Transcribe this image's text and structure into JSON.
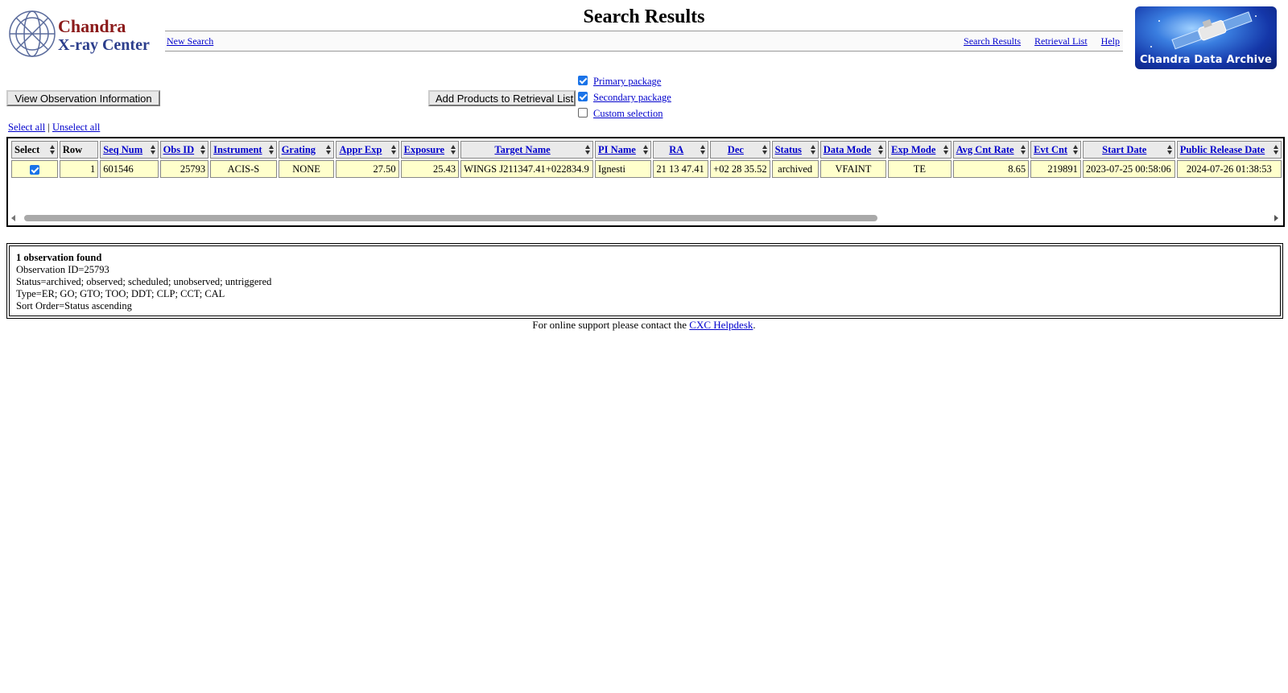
{
  "header": {
    "logo_line1": "Chandra",
    "logo_line2": "X-ray Center",
    "title": "Search Results",
    "right_logo_text": "Chandra Data Archive"
  },
  "nav": {
    "new_search": "New Search",
    "links": [
      "Search Results",
      "Retrieval List",
      "Help"
    ]
  },
  "actions": {
    "view_obs_button": "View Observation Information",
    "add_products_button": "Add Products to Retrieval List",
    "packages": [
      {
        "label": "Primary package",
        "checked": true
      },
      {
        "label": "Secondary package",
        "checked": true
      },
      {
        "label": "Custom selection",
        "checked": false
      }
    ],
    "select_all": "Select all",
    "separator": "|",
    "unselect_all": "Unselect all"
  },
  "table": {
    "columns": [
      "Select",
      "Row",
      "Seq Num",
      "Obs ID",
      "Instrument",
      "Grating",
      "Appr Exp",
      "Exposure",
      "Target Name",
      "PI Name",
      "RA",
      "Dec",
      "Status",
      "Data Mode",
      "Exp Mode",
      "Avg Cnt Rate",
      "Evt Cnt",
      "Start Date",
      "Public Release Date"
    ],
    "rows": [
      {
        "selected": true,
        "row": "1",
        "seq_num": "601546",
        "obs_id": "25793",
        "instrument": "ACIS-S",
        "grating": "NONE",
        "appr_exp": "27.50",
        "exposure": "25.43",
        "target_name": "WINGS J211347.41+022834.9",
        "pi_name": "Ignesti",
        "ra": "21 13 47.41",
        "dec": "+02 28 35.52",
        "status": "archived",
        "data_mode": "VFAINT",
        "exp_mode": "TE",
        "avg_cnt_rate": "8.65",
        "evt_cnt": "219891",
        "start_date": "2023-07-25 00:58:06",
        "public_release_date": "2024-07-26 01:38:53"
      }
    ]
  },
  "summary": {
    "count": "1 observation found",
    "lines": [
      "Observation ID=25793",
      "Status=archived; observed; scheduled; unobserved; untriggered",
      "Type=ER; GO; GTO; TOO; DDT; CLP; CCT; CAL",
      "Sort Order=Status ascending"
    ]
  },
  "footer": {
    "prefix": "For online support please contact the",
    "link": "CXC Helpdesk",
    "suffix": "."
  },
  "colors": {
    "link": "#0000cc",
    "cell_background": "#ffffcc",
    "header_background": "#eaeaea",
    "checkbox_accent": "#1a73e8"
  }
}
